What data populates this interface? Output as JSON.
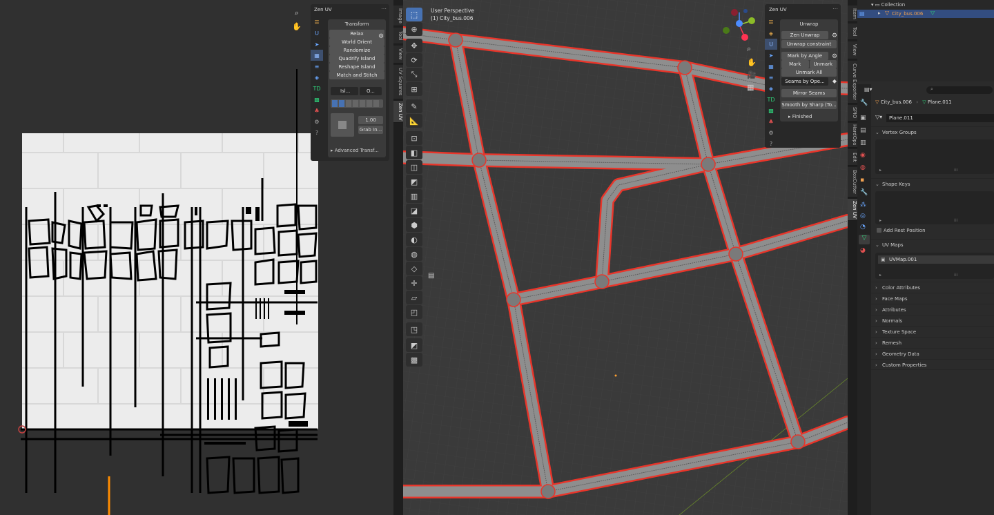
{
  "uv_panel": {
    "title": "Zen UV",
    "section": "Transform",
    "buttons": [
      "Relax",
      "World Orient",
      "Randomize",
      "Quadrify Island",
      "Reshape Island",
      "Match and Stitch"
    ],
    "island_select": "Isl...",
    "origin_select": "O...",
    "value": "1.00",
    "grab_button": "Grab In...",
    "advanced": "Advanced Transf..."
  },
  "left_tabs": [
    "Image",
    "Tool",
    "View",
    "UV Squares",
    "Zen UV"
  ],
  "viewport": {
    "mode": "User Perspective",
    "object": "(1) City_bus.006"
  },
  "unwrap_panel": {
    "title": "Zen UV",
    "section": "Unwrap",
    "zen_unwrap": "Zen Unwrap",
    "unwrap_constraint": "Unwrap constraint",
    "mark_by_angle": "Mark by Angle",
    "mark": "Mark",
    "unmark": "Unmark",
    "unmark_all": "Unmark All",
    "seams_by": "Seams by Ope...",
    "mirror_seams": "Mirror Seams",
    "smooth_by_sharp": "Smooth by Sharp (To...",
    "finished": "Finished"
  },
  "right_tabs": [
    "Item",
    "Tool",
    "View",
    "Curve Exporter",
    "SPIO",
    "HardOps",
    "Edit",
    "BoxCutter",
    "Zen UV"
  ],
  "outliner": {
    "collection": "Collection",
    "object": "City_bus.006"
  },
  "properties": {
    "search_placeholder": "",
    "breadcrumb_object": "City_bus.006",
    "breadcrumb_mesh": "Plane.011",
    "mesh_name": "Plane.011",
    "vertex_groups": "Vertex Groups",
    "shape_keys": "Shape Keys",
    "add_rest_position": "Add Rest Position",
    "uv_maps": "UV Maps",
    "uv_map_item": "UVMap.001",
    "collapsed_sections": [
      "Color Attributes",
      "Face Maps",
      "Attributes",
      "Normals",
      "Texture Space",
      "Remesh",
      "Geometry Data",
      "Custom Properties"
    ]
  },
  "colors": {
    "accent_blue": "#4772b3",
    "road_outline": "#e8352a",
    "road_fill": "#8e8e8e"
  }
}
